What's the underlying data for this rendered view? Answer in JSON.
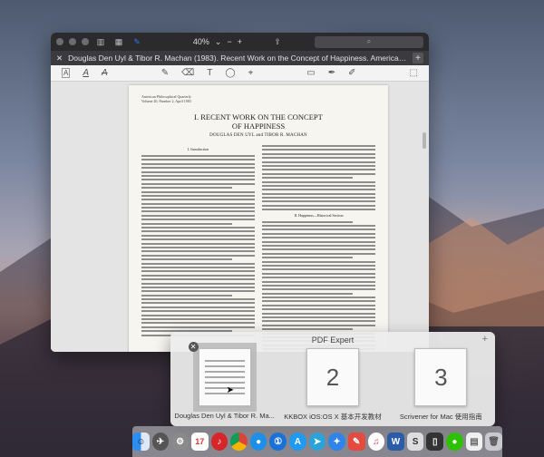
{
  "window": {
    "zoom_level": "40%",
    "tab_title": "Douglas Den Uyl & Tibor R. Machan (1983). Recent Work on the Concept of Happiness. American Philosophi..."
  },
  "document": {
    "journal_line1": "American Philosophical Quarterly",
    "journal_line2": "Volume 20, Number 2, April 1983",
    "title_line1": "I. RECENT WORK ON THE CONCEPT",
    "title_line2": "OF HAPPINESS",
    "authors": "DOUGLAS DEN UYL and TIBOR R. MACHAN",
    "section_intro": "I. Introduction",
    "section_history": "II. Happiness—Historical Section"
  },
  "switcher": {
    "title": "PDF Expert",
    "items": [
      {
        "label": "Douglas Den Uyl & Tibor R. Ma...",
        "num": ""
      },
      {
        "label": "KKBOX iOS:OS X 基本开发教材",
        "num": "2"
      },
      {
        "label": "Scrivener for Mac 使用指南",
        "num": "3"
      }
    ]
  },
  "colors": {
    "accent": "#2f7ae5"
  }
}
